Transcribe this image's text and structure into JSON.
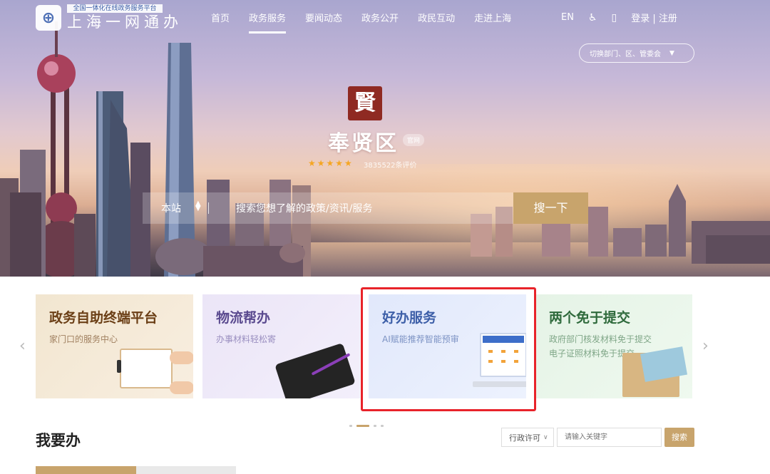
{
  "header": {
    "logo_sub": "全国一体化在线政务服务平台",
    "logo_main": "上海一网通办",
    "nav": [
      "首页",
      "政务服务",
      "要闻动态",
      "政务公开",
      "政民互动",
      "走进上海"
    ],
    "active_nav": "政务服务",
    "lang": "EN",
    "login": "登录 | 注册",
    "switch_label": "切换部门、区、管委会"
  },
  "district": {
    "seal": "賢",
    "name": "奉贤区",
    "tag": "官网",
    "stars": "★★★★★",
    "rating_text": "3835522条评价"
  },
  "search": {
    "scope": "本站",
    "placeholder": "搜索您想了解的政策/资讯/服务",
    "button": "搜一下"
  },
  "carousel": {
    "prev": "‹",
    "next": "›",
    "cards": [
      {
        "title": "政务自助终端平台",
        "lines": [
          "家门口的服务中心"
        ]
      },
      {
        "title": "物流帮办",
        "lines": [
          "办事材料轻松寄"
        ]
      },
      {
        "title": "好办服务",
        "lines": [
          "AI赋能推荐智能预审"
        ]
      },
      {
        "title": "两个免于提交",
        "lines": [
          "政府部门核发材料免于提交",
          "电子证照材料免于提交"
        ]
      }
    ],
    "highlight_color": "#e8232a",
    "accent_color": "#c8a46c"
  },
  "section": {
    "title": "我要办",
    "filter": "行政许可",
    "keyword_placeholder": "请输入关键字",
    "search_button": "搜索"
  }
}
